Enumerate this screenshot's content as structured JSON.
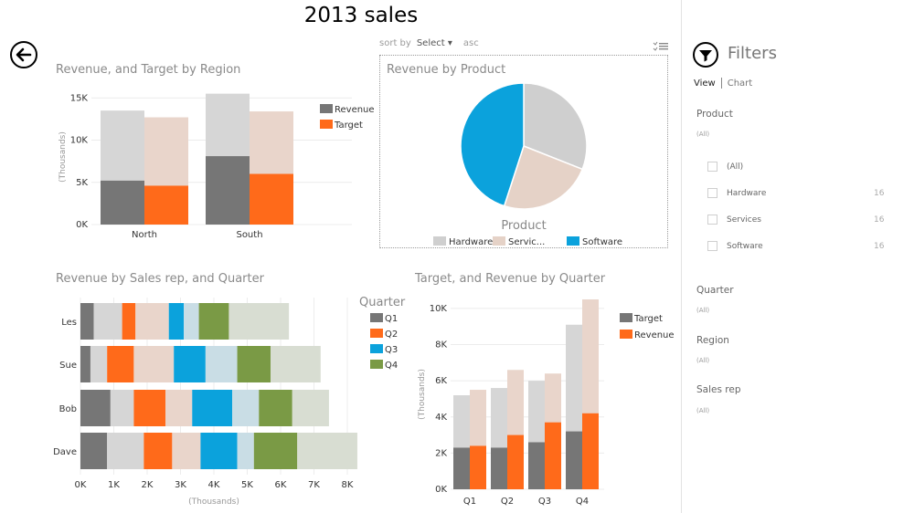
{
  "page": {
    "title": "2013 sales"
  },
  "sort": {
    "label": "sort by",
    "select": "Select",
    "order": "asc"
  },
  "charts": {
    "region": {
      "title": "Revenue, and Target by Region",
      "ylabel": "(Thousands)",
      "ticks": [
        "0K",
        "5K",
        "10K",
        "15K"
      ],
      "ylim": [
        0,
        16000
      ],
      "categories": [
        "North",
        "South"
      ],
      "series": [
        {
          "name": "Revenue",
          "total": [
            13500,
            15500
          ],
          "highlight": [
            5200,
            8100
          ],
          "color": "#767676",
          "light": "#d6d6d6"
        },
        {
          "name": "Target",
          "total": [
            12700,
            13400
          ],
          "highlight": [
            4600,
            6000
          ],
          "color": "#ff6a1a",
          "light": "#e9d5cb"
        }
      ]
    },
    "product": {
      "title": "Revenue by Product",
      "legend_title": "Product",
      "slices": [
        {
          "name": "Hardware",
          "legend_label": "Hardware",
          "value": 31,
          "color": "#cfcfcf"
        },
        {
          "name": "Services",
          "legend_label": "Servic...",
          "value": 24,
          "color": "#e5d2c7"
        },
        {
          "name": "Software",
          "legend_label": "Software",
          "value": 45,
          "color": "#0ba2dc"
        }
      ]
    },
    "salesrep": {
      "title": "Revenue by Sales rep, and Quarter",
      "xlabel": "(Thousands)",
      "ticks": [
        "0K",
        "1K",
        "2K",
        "3K",
        "4K",
        "5K",
        "6K",
        "7K",
        "8K"
      ],
      "xlim": [
        0,
        8000
      ],
      "legend_title": "Quarter",
      "categories": [
        "Les",
        "Sue",
        "Bob",
        "Dave"
      ],
      "quarters": [
        {
          "name": "Q1",
          "color": "#767676",
          "light": "#d6d6d6"
        },
        {
          "name": "Q2",
          "color": "#ff6a1a",
          "light": "#e9d5cb"
        },
        {
          "name": "Q3",
          "color": "#0ba2dc",
          "light": "#c9dde5"
        },
        {
          "name": "Q4",
          "color": "#7a9a45",
          "light": "#d8ddd2"
        }
      ],
      "rows": [
        {
          "hl": [
            400,
            400,
            450,
            900
          ],
          "lt": [
            850,
            1000,
            450,
            1800
          ]
        },
        {
          "hl": [
            300,
            800,
            950,
            1000
          ],
          "lt": [
            500,
            1200,
            950,
            1500
          ]
        },
        {
          "hl": [
            900,
            950,
            1200,
            1000
          ],
          "lt": [
            700,
            800,
            800,
            1100
          ]
        },
        {
          "hl": [
            800,
            850,
            1100,
            1300
          ],
          "lt": [
            1100,
            850,
            500,
            1800
          ]
        }
      ]
    },
    "quarter": {
      "title": "Target, and Revenue by Quarter",
      "ylabel": "(Thousands)",
      "ticks": [
        "0K",
        "2K",
        "4K",
        "6K",
        "8K",
        "10K"
      ],
      "ylim": [
        0,
        10500
      ],
      "categories": [
        "Q1",
        "Q2",
        "Q3",
        "Q4"
      ],
      "series": [
        {
          "name": "Target",
          "total": [
            5200,
            5600,
            6000,
            9100
          ],
          "highlight": [
            2300,
            2300,
            2600,
            3200
          ],
          "color": "#767676",
          "light": "#d6d6d6"
        },
        {
          "name": "Revenue",
          "total": [
            5500,
            6600,
            6400,
            10500
          ],
          "highlight": [
            2400,
            3000,
            3700,
            4200
          ],
          "color": "#ff6a1a",
          "light": "#e9d5cb"
        }
      ]
    }
  },
  "filters": {
    "title": "Filters",
    "view_tab": "View",
    "chart_tab": "Chart",
    "product": {
      "title": "Product",
      "selection": "(All)",
      "items": [
        {
          "label": "(All)",
          "count": ""
        },
        {
          "label": "Hardware",
          "count": "16"
        },
        {
          "label": "Services",
          "count": "16"
        },
        {
          "label": "Software",
          "count": "16"
        }
      ]
    },
    "quarter": {
      "title": "Quarter",
      "selection": "(All)"
    },
    "region": {
      "title": "Region",
      "selection": "(All)"
    },
    "salesrep": {
      "title": "Sales rep",
      "selection": "(All)"
    }
  }
}
